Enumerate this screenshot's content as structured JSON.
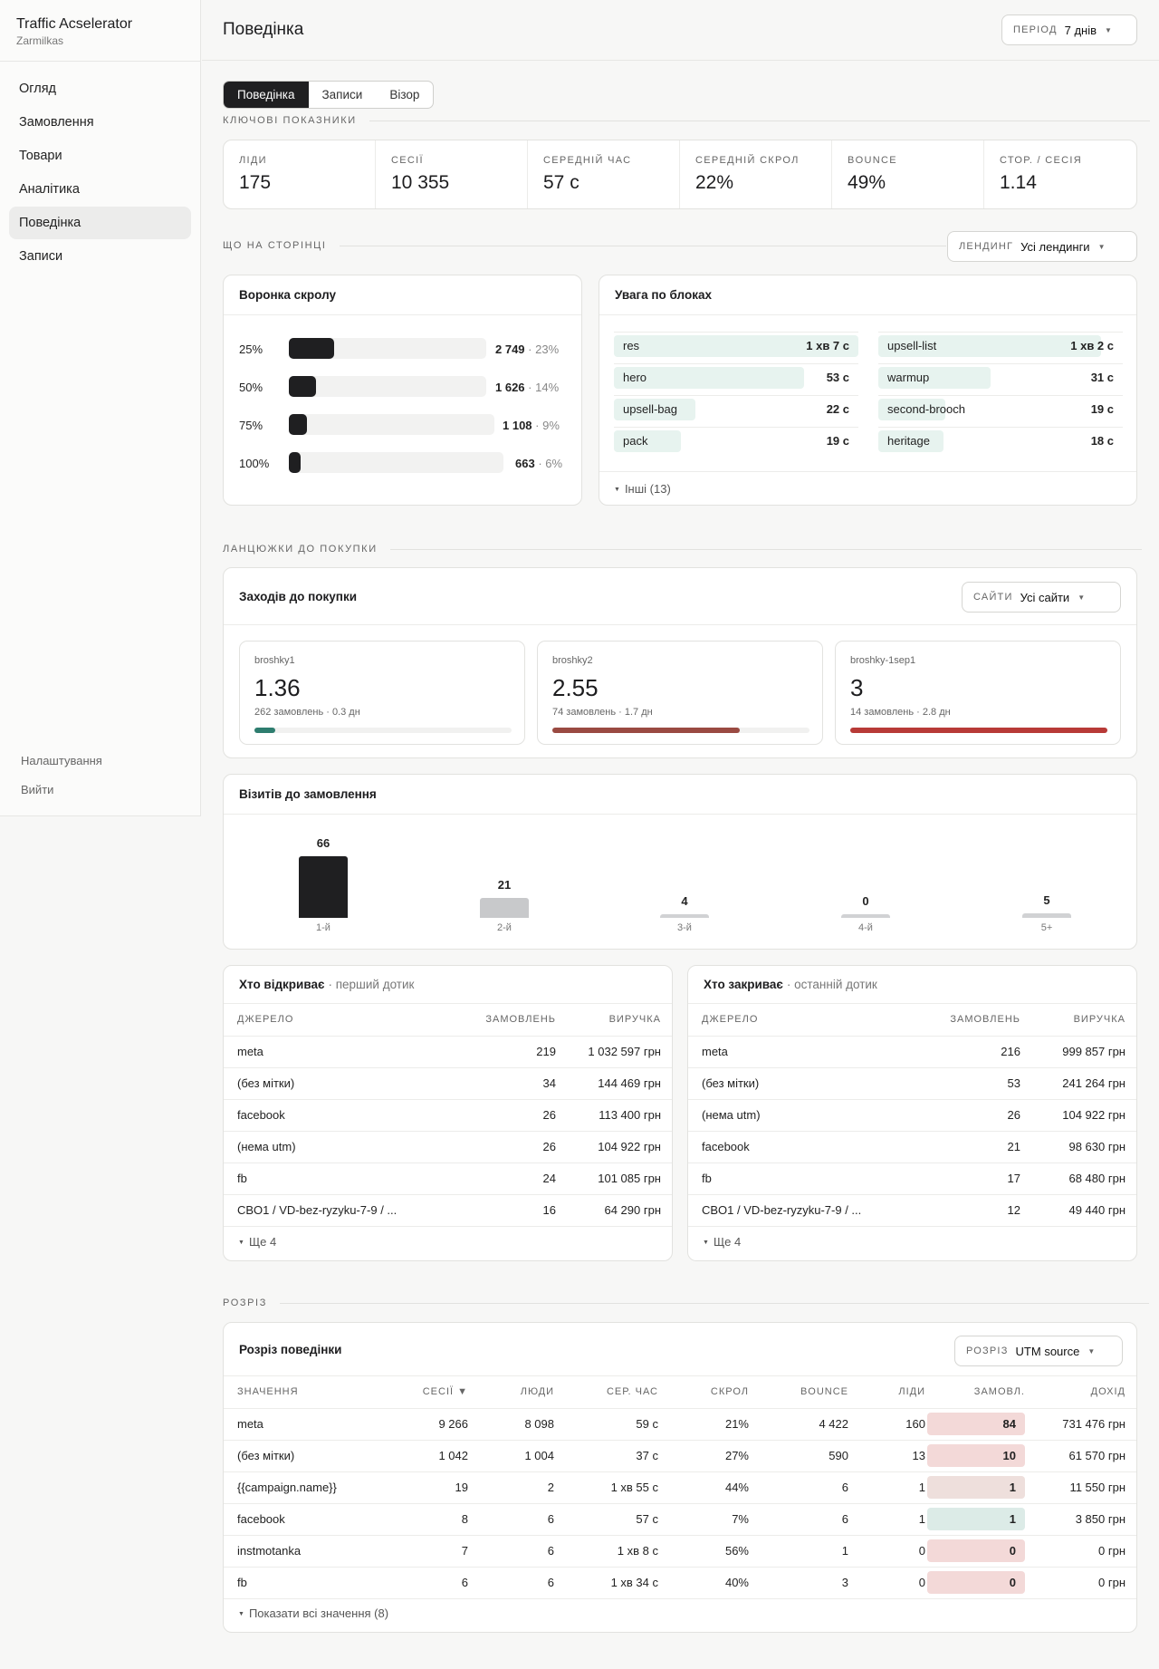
{
  "app": {
    "title": "Traffic Acselerator",
    "subtitle": "Zarmilkas"
  },
  "nav": {
    "items": [
      "Огляд",
      "Замовлення",
      "Товари",
      "Аналітика",
      "Поведінка",
      "Записи"
    ],
    "active": 4,
    "footer": [
      "Налаштування",
      "Вийти"
    ]
  },
  "header": {
    "title": "Поведінка",
    "period_label": "Період",
    "period_value": "7 днів"
  },
  "tabs": [
    "Поведінка",
    "Записи",
    "Візор"
  ],
  "sections": {
    "kpi": "Ключові показники",
    "page": "Що на сторінці",
    "chains": "Ланцюжки до покупки",
    "split": "Розріз"
  },
  "kpis": [
    {
      "label": "Ліди",
      "value": "175"
    },
    {
      "label": "Сесії",
      "value": "10 355"
    },
    {
      "label": "Середній час",
      "value": "57 с"
    },
    {
      "label": "Середній скрол",
      "value": "22%"
    },
    {
      "label": "Bounce",
      "value": "49%"
    },
    {
      "label": "Стор. / сесія",
      "value": "1.14"
    }
  ],
  "landing": {
    "label": "Лендинг",
    "value": "Усі лендинги"
  },
  "funnel": {
    "title": "Воронка скролу",
    "rows": [
      {
        "label": "25%",
        "count": "2 749",
        "pct": "23%",
        "share": 0.23
      },
      {
        "label": "50%",
        "count": "1 626",
        "pct": "14%",
        "share": 0.14
      },
      {
        "label": "75%",
        "count": "1 108",
        "pct": "9%",
        "share": 0.09
      },
      {
        "label": "100%",
        "count": "663",
        "pct": "6%",
        "share": 0.06
      }
    ]
  },
  "attention": {
    "title": "Увага по блоках",
    "left": [
      {
        "name": "res",
        "value": "1 хв 7 с",
        "share": 1.0
      },
      {
        "name": "hero",
        "value": "53 с",
        "share": 0.79
      },
      {
        "name": "upsell-bag",
        "value": "22 с",
        "share": 0.33
      },
      {
        "name": "pack",
        "value": "19 с",
        "share": 0.28
      }
    ],
    "right": [
      {
        "name": "upsell-list",
        "value": "1 хв 2 с",
        "share": 0.93
      },
      {
        "name": "warmup",
        "value": "31 с",
        "share": 0.46
      },
      {
        "name": "second-brooch",
        "value": "19 с",
        "share": 0.28
      },
      {
        "name": "heritage",
        "value": "18 с",
        "share": 0.27
      }
    ],
    "more": "Інші (13)"
  },
  "visits_to_buy": {
    "title": "Заходів до покупки",
    "sites_label": "Сайти",
    "sites_value": "Усі сайти",
    "cards": [
      {
        "name": "broshky1",
        "value": "1.36",
        "meta": "262 замовлень · 0.3 дн",
        "level": 0.08,
        "color": "#2e7d6f"
      },
      {
        "name": "broshky2",
        "value": "2.55",
        "meta": "74 замовлень · 1.7 дн",
        "level": 0.73,
        "color": "#9a4a42"
      },
      {
        "name": "broshky-1sep1",
        "value": "3",
        "meta": "14 замовлень · 2.8 дн",
        "level": 1.0,
        "color": "#b83a37"
      }
    ]
  },
  "chart_data": {
    "type": "bar",
    "title": "Візитів до замовлення",
    "categories": [
      "1-й",
      "2-й",
      "3-й",
      "4-й",
      "5+"
    ],
    "values": [
      66,
      21,
      4,
      0,
      5
    ],
    "ylim": [
      0,
      66
    ]
  },
  "first_touch": {
    "title": "Хто відкриває",
    "subtitle": "· перший дотик",
    "columns": [
      "Джерело",
      "Замовлень",
      "Виручка"
    ],
    "rows": [
      [
        "meta",
        "219",
        "1 032 597 грн"
      ],
      [
        "(без мітки)",
        "34",
        "144 469 грн"
      ],
      [
        "facebook",
        "26",
        "113 400 грн"
      ],
      [
        "(нема utm)",
        "26",
        "104 922 грн"
      ],
      [
        "fb",
        "24",
        "101 085 грн"
      ],
      [
        "CBO1 / VD-bez-ryzyku-7-9 / ...",
        "16",
        "64 290 грн"
      ]
    ],
    "more": "Ще 4"
  },
  "last_touch": {
    "title": "Хто закриває",
    "subtitle": "· останній дотик",
    "columns": [
      "Джерело",
      "Замовлень",
      "Виручка"
    ],
    "rows": [
      [
        "meta",
        "216",
        "999 857 грн"
      ],
      [
        "(без мітки)",
        "53",
        "241 264 грн"
      ],
      [
        "(нема utm)",
        "26",
        "104 922 грн"
      ],
      [
        "facebook",
        "21",
        "98 630 грн"
      ],
      [
        "fb",
        "17",
        "68 480 грн"
      ],
      [
        "CBO1 / VD-bez-ryzyku-7-9 / ...",
        "12",
        "49 440 грн"
      ]
    ],
    "more": "Ще 4"
  },
  "split": {
    "title": "Розріз поведінки",
    "select_label": "Розріз",
    "select_value": "UTM source",
    "columns": [
      "Значення",
      "Сесії ▼",
      "Люди",
      "Сер. час",
      "Скрол",
      "Bounce",
      "Ліди",
      "Замовл.",
      "Дохід"
    ],
    "rows": [
      [
        "meta",
        "9 266",
        "8 098",
        "59 с",
        "21%",
        "4 422",
        "160",
        "84",
        "731 476 грн"
      ],
      [
        "(без мітки)",
        "1 042",
        "1 004",
        "37 с",
        "27%",
        "590",
        "13",
        "10",
        "61 570 грн"
      ],
      [
        "{{campaign.name}}",
        "19",
        "2",
        "1 хв 55 с",
        "44%",
        "6",
        "1",
        "1",
        "11 550 грн"
      ],
      [
        "facebook",
        "8",
        "6",
        "57 с",
        "7%",
        "6",
        "1",
        "1",
        "3 850 грн"
      ],
      [
        "instmotanka",
        "7",
        "6",
        "1 хв 8 с",
        "56%",
        "1",
        "0",
        "0",
        "0 грн"
      ],
      [
        "fb",
        "6",
        "6",
        "1 хв 34 с",
        "40%",
        "3",
        "0",
        "0",
        "0 грн"
      ]
    ],
    "pill_colors": [
      "#f3d9d8",
      "#f3d9d8",
      "#eedfdc",
      "#dcebe7",
      "#f3d9d8",
      "#f3d9d8"
    ],
    "more": "Показати всі значення (8)"
  }
}
